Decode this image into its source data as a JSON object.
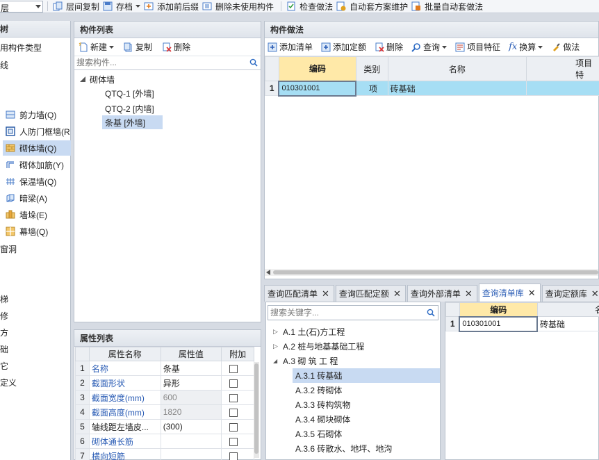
{
  "toolbar": {
    "combo_value": "层",
    "buttons": [
      {
        "label": "层间复制",
        "icon": "floor-copy-icon"
      },
      {
        "label": "存档",
        "icon": "archive-icon"
      },
      {
        "label": "添加前后缀",
        "icon": "add-prefix-suffix-icon"
      },
      {
        "label": "删除未使用构件",
        "icon": "delete-unused-icon"
      },
      {
        "label": "检查做法",
        "icon": "check-method-icon"
      },
      {
        "label": "自动套方案维护",
        "icon": "auto-scheme-icon"
      },
      {
        "label": "批量自动套做法",
        "icon": "batch-auto-icon"
      }
    ]
  },
  "left_panel": {
    "title": "树",
    "items_top": [
      "用构件类型",
      "线"
    ],
    "sub_items": [
      {
        "label": "剪力墙(Q)",
        "icon": "shear-wall-icon"
      },
      {
        "label": "人防门框墙(R",
        "icon": "civil-defense-door-wall-icon"
      },
      {
        "label": "砌体墙(Q)",
        "icon": "masonry-wall-icon",
        "selected": true
      },
      {
        "label": "砌体加筋(Y)",
        "icon": "masonry-rebar-icon"
      },
      {
        "label": "保温墙(Q)",
        "icon": "insulation-wall-icon"
      },
      {
        "label": "暗梁(A)",
        "icon": "hidden-beam-icon"
      },
      {
        "label": "墙垛(E)",
        "icon": "wall-pier-icon"
      },
      {
        "label": "幕墙(Q)",
        "icon": "curtain-wall-icon"
      }
    ],
    "items_bottom": [
      "窗洞",
      "梯",
      "修",
      "方",
      "础",
      "它",
      "定义"
    ]
  },
  "component_list": {
    "title": "构件列表",
    "new_label": "新建",
    "copy_label": "复制",
    "delete_label": "删除",
    "search_placeholder": "搜索构件...",
    "root": "砌体墙",
    "children": [
      "QTQ-1 [外墙]",
      "QTQ-2 [内墙]",
      "条基 [外墙]"
    ]
  },
  "property_list": {
    "title": "属性列表",
    "headers": [
      "属性名称",
      "属性值",
      "附加"
    ],
    "rows": [
      {
        "num": "1",
        "name": "名称",
        "value": "条基"
      },
      {
        "num": "2",
        "name": "截面形状",
        "value": "异形"
      },
      {
        "num": "3",
        "name": "截面宽度(mm)",
        "value": "600"
      },
      {
        "num": "4",
        "name": "截面高度(mm)",
        "value": "1820"
      },
      {
        "num": "5",
        "name": "轴线距左墙皮...",
        "value": "(300)"
      },
      {
        "num": "6",
        "name": "砌体通长筋",
        "value": ""
      },
      {
        "num": "7",
        "name": "横向短筋",
        "value": ""
      }
    ]
  },
  "component_method": {
    "title": "构件做法",
    "toolbar": [
      "添加清单",
      "添加定额",
      "删除",
      "查询",
      "项目特征",
      "换算",
      "做法"
    ],
    "headers": [
      "编码",
      "类别",
      "名称",
      "项目特"
    ],
    "rows": [
      {
        "num": "1",
        "code": "010301001",
        "type": "项",
        "name": "砖基础",
        "feature": ""
      }
    ]
  },
  "tabs": [
    {
      "label": "查询匹配清单",
      "active": false
    },
    {
      "label": "查询匹配定额",
      "active": false
    },
    {
      "label": "查询外部清单",
      "active": false
    },
    {
      "label": "查询清单库",
      "active": true
    },
    {
      "label": "查询定额库",
      "active": false
    }
  ],
  "query_library": {
    "search_placeholder": "搜索关键字...",
    "tree": [
      {
        "label": "A.1  土(石)方工程",
        "level": 0,
        "expander": "▷"
      },
      {
        "label": "A.2  桩与地基基础工程",
        "level": 0,
        "expander": "▷"
      },
      {
        "label": "A.3  砌 筑 工 程",
        "level": 0,
        "expander": "◢"
      },
      {
        "label": "A.3.1  砖基础",
        "level": 1,
        "selected": true
      },
      {
        "label": "A.3.2  砖砌体",
        "level": 1
      },
      {
        "label": "A.3.3  砖构筑物",
        "level": 1
      },
      {
        "label": "A.3.4  砌块砌体",
        "level": 1
      },
      {
        "label": "A.3.5  石砌体",
        "level": 1
      },
      {
        "label": "A.3.6  砖散水、地坪、地沟",
        "level": 1
      }
    ],
    "grid_headers": [
      "编码",
      "名称"
    ],
    "grid_rows": [
      {
        "num": "1",
        "code": "010301001",
        "name": "砖基础"
      }
    ]
  },
  "colors": {
    "selection": "#c8daf2",
    "grid_selection": "#a6def4",
    "link_blue": "#2a5cb5"
  }
}
